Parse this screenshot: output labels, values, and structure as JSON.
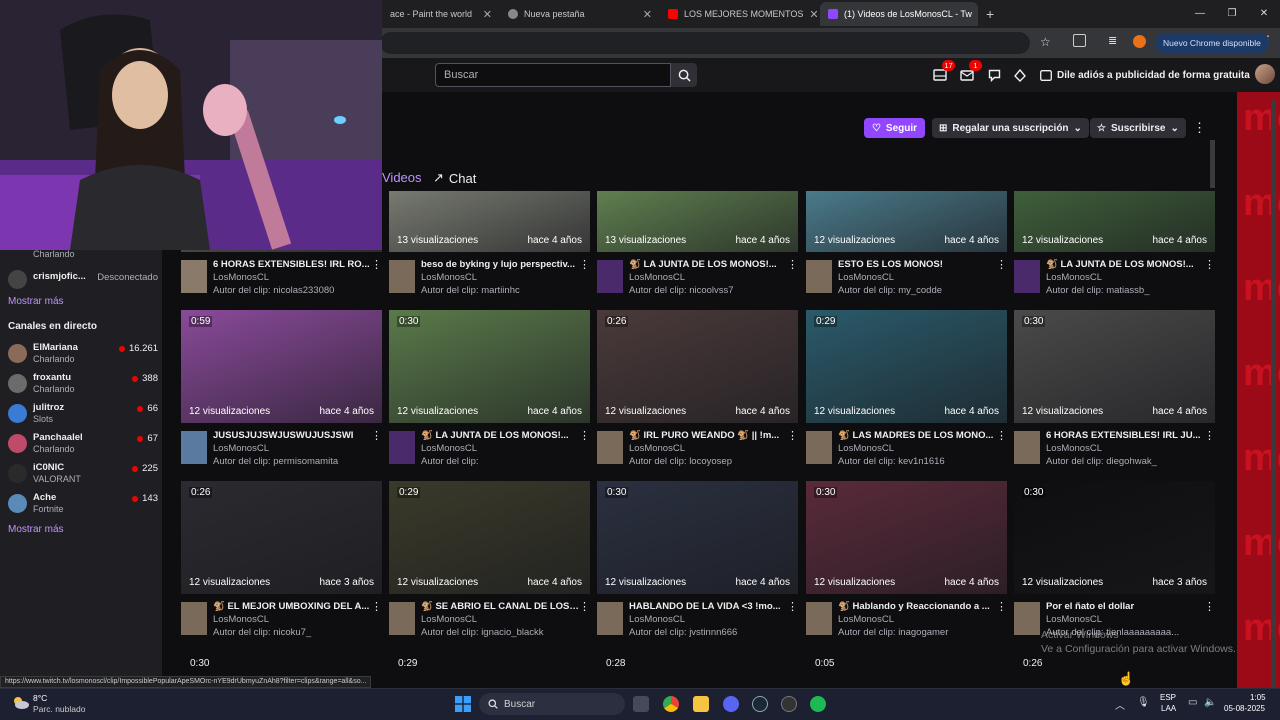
{
  "browser": {
    "tabs": [
      {
        "title": "ace - Paint the world",
        "active": false
      },
      {
        "title": "Nueva pestaña",
        "active": false
      },
      {
        "title": "LOS MEJORES MOMENTOS",
        "active": false
      },
      {
        "title": "(1) Videos de LosMonosCL - Tw",
        "active": true
      }
    ],
    "new_tab": "+",
    "chrome_badge": "Nuevo Chrome disponible",
    "window_controls": [
      "—",
      "❐",
      "✕"
    ]
  },
  "topnav": {
    "search_placeholder": "Buscar",
    "inbox_badge": "17",
    "whispers_badge": "1",
    "adfree": "Dile adiós a publicidad de forma gratuita"
  },
  "sidebar": {
    "partial_cat": "Charlando",
    "offline_name": "crismjofic...",
    "offline_status": "Desconectado",
    "show_more_1": "Mostrar más",
    "live_header": "Canales en directo",
    "channels": [
      {
        "name": "ElMariana",
        "cat": "Charlando",
        "viewers": "16.261",
        "color": "#8b6a5a"
      },
      {
        "name": "froxantu",
        "cat": "Charlando",
        "viewers": "388",
        "color": "#6b6b6b"
      },
      {
        "name": "julitroz",
        "cat": "Slots",
        "viewers": "66",
        "color": "#3a7bd5"
      },
      {
        "name": "Panchaalel",
        "cat": "Charlando",
        "viewers": "67",
        "color": "#c04a6a"
      },
      {
        "name": "iC0NIC",
        "cat": "VALORANT",
        "viewers": "225",
        "color": "#2a2a2a"
      },
      {
        "name": "Ache",
        "cat": "Fortnite",
        "viewers": "143",
        "color": "#5a8ab8"
      }
    ],
    "show_more_2": "Mostrar más"
  },
  "channel_header": {
    "follow": "Seguir",
    "gift": "Regalar una suscripción",
    "subscribe": "Suscribirse",
    "tab_videos": "Videos",
    "tab_chat": "Chat"
  },
  "rows": [
    [
      {
        "dur": "",
        "views": "13 visualizaciones",
        "ago": "hace 4 años",
        "title": "6 HORAS EXTENSIBLES! IRL RO...",
        "channel": "LosMonosCL",
        "clip": "Autor del clip: nicolas233080",
        "thumb": "#5a5a55",
        "av": "#8a7a6a"
      },
      {
        "dur": "",
        "views": "13 visualizaciones",
        "ago": "hace 4 años",
        "title": "beso de byking y lujo perspectiv...",
        "channel": "LosMonosCL",
        "clip": "Autor del clip: martiinhc",
        "thumb": "#777a70",
        "av": "#7a6a5a"
      },
      {
        "dur": "",
        "views": "13 visualizaciones",
        "ago": "hace 4 años",
        "title": "🐒 LA JUNTA DE LOS MONOS!...",
        "channel": "LosMonosCL",
        "clip": "Autor del clip: nicoolvss7",
        "thumb": "#5f7f4f",
        "av": "#4a2a6a"
      },
      {
        "dur": "",
        "views": "12 visualizaciones",
        "ago": "hace 4 años",
        "title": "ESTO ES LOS MONOS!",
        "channel": "LosMonosCL",
        "clip": "Autor del clip: my_codde",
        "thumb": "#4a7a8a",
        "av": "#7a6a5a"
      },
      {
        "dur": "",
        "views": "12 visualizaciones",
        "ago": "hace 4 años",
        "title": "🐒 LA JUNTA DE LOS MONOS!...",
        "channel": "LosMonosCL",
        "clip": "Autor del clip: matiassb_",
        "thumb": "#3f5f3a",
        "av": "#4a2a6a"
      }
    ],
    [
      {
        "dur": "0:59",
        "views": "12 visualizaciones",
        "ago": "hace 4 años",
        "title": "JUSUSJUJSWJUSWUJUSJSWI",
        "channel": "LosMonosCL",
        "clip": "Autor del clip: permisomamita",
        "thumb": "#8a4a9a",
        "av": "#5a7aa0"
      },
      {
        "dur": "0:30",
        "views": "12 visualizaciones",
        "ago": "hace 4 años",
        "title": "🐒 LA JUNTA DE LOS MONOS!...",
        "channel": "LosMonosCL",
        "clip": "Autor del clip:",
        "thumb": "#5a7a4a",
        "av": "#4a2a6a"
      },
      {
        "dur": "0:26",
        "views": "12 visualizaciones",
        "ago": "hace 4 años",
        "title": "🐒 IRL PURO WEANDO 🐒 || !m...",
        "channel": "LosMonosCL",
        "clip": "Autor del clip: locoyosep",
        "thumb": "#4a3a3a",
        "av": "#7a6a5a"
      },
      {
        "dur": "0:29",
        "views": "12 visualizaciones",
        "ago": "hace 4 años",
        "title": "🐒 LAS MADRES DE LOS MONO...",
        "channel": "LosMonosCL",
        "clip": "Autor del clip: kev1n1616",
        "thumb": "#2a5a6a",
        "av": "#7a6a5a"
      },
      {
        "dur": "0:30",
        "views": "12 visualizaciones",
        "ago": "hace 4 años",
        "title": "6 HORAS EXTENSIBLES! IRL JU...",
        "channel": "LosMonosCL",
        "clip": "Autor del clip: diegohwak_",
        "thumb": "#4a4a4a",
        "av": "#7a6a5a"
      }
    ],
    [
      {
        "dur": "0:26",
        "views": "12 visualizaciones",
        "ago": "hace 3 años",
        "title": "🐒 EL MEJOR UMBOXING DEL A...",
        "channel": "LosMonosCL",
        "clip": "Autor del clip: nicoku7_",
        "thumb": "#2a2a30",
        "av": "#7a6a5a"
      },
      {
        "dur": "0:29",
        "views": "12 visualizaciones",
        "ago": "hace 4 años",
        "title": "🐒 SE ABRIO EL CANAL DE LOS ...",
        "channel": "LosMonosCL",
        "clip": "Autor del clip: ignacio_blackk",
        "thumb": "#3a3a2a",
        "av": "#7a6a5a"
      },
      {
        "dur": "0:30",
        "views": "12 visualizaciones",
        "ago": "hace 4 años",
        "title": "HABLANDO DE LA VIDA <3 !mo...",
        "channel": "LosMonosCL",
        "clip": "Autor del clip: jvstinnn666",
        "thumb": "#2a3040",
        "av": "#7a6a5a"
      },
      {
        "dur": "0:30",
        "views": "12 visualizaciones",
        "ago": "hace 4 años",
        "title": "🐒 Hablando y Reaccionando a ...",
        "channel": "LosMonosCL",
        "clip": "Autor del clip: inagogamer",
        "thumb": "#5a2a3a",
        "av": "#7a6a5a"
      },
      {
        "dur": "0:30",
        "views": "12 visualizaciones",
        "ago": "hace 3 años",
        "title": "Por el ñato el dollar",
        "channel": "LosMonosCL",
        "clip": "Autor del clip: tienlaaaaaaaaa...",
        "thumb": "#0e0e10",
        "av": "#7a6a5a"
      }
    ]
  ],
  "bottom_durations": [
    "0:30",
    "0:29",
    "0:28",
    "0:05",
    "0:26"
  ],
  "status_url": "https://www.twitch.tv/losmonoscl/clip/ImpossiblePopularApeSMOrc-nYE9drUbmyuZnAh8?filter=clips&range=all&so...",
  "watermark": {
    "line1": "Activar Windows",
    "line2": "Ve a Configuración para activar Windows."
  },
  "taskbar": {
    "weather_temp": "8°C",
    "weather_desc": "Parc. nublado",
    "search": "Buscar",
    "lang1": "ESP",
    "lang2": "LAA",
    "time": "1:05",
    "date": "05-08-2025"
  },
  "right_strip_text": "mo"
}
